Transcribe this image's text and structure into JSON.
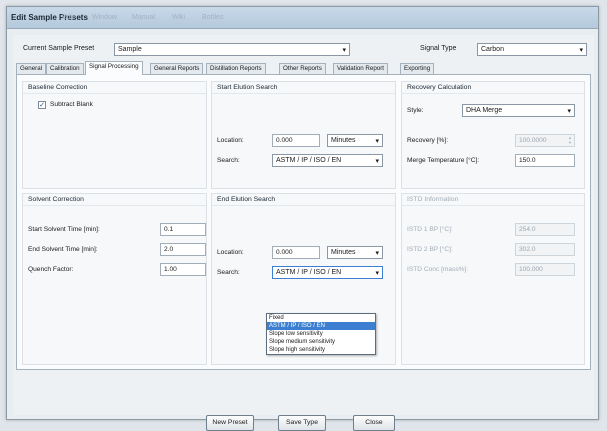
{
  "window": {
    "title": "Edit Sample Presets",
    "ghost_menu": [
      "Edit",
      "Window",
      "Manual",
      "Wiki",
      "Bottles"
    ]
  },
  "header": {
    "preset_label": "Current Sample Preset",
    "preset_value": "Sample",
    "signal_label": "Signal Type",
    "signal_value": "Carbon"
  },
  "tabs": [
    "General",
    "Calibration",
    "Signal Processing",
    "General Reports",
    "Distillation Reports",
    "Other Reports",
    "Validation Report",
    "Exporting"
  ],
  "active_tab": "Signal Processing",
  "baseline": {
    "title": "Baseline Correction",
    "subtract_label": "Subtract Blank",
    "subtract_checked": true
  },
  "start_elution": {
    "title": "Start Elution Search",
    "location_label": "Location:",
    "location_value": "0.000",
    "unit_value": "Minutes",
    "search_label": "Search:",
    "search_value": "ASTM / IP / ISO / EN"
  },
  "recovery": {
    "title": "Recovery Calculation",
    "style_label": "Style:",
    "style_value": "DHA Merge",
    "recovery_label": "Recovery [%]:",
    "recovery_value": "100.0000",
    "merge_label": "Merge Temperature [°C]:",
    "merge_value": "150.0"
  },
  "solvent": {
    "title": "Solvent Correction",
    "start_label": "Start Solvent Time [min]:",
    "start_value": "0.1",
    "end_label": "End Solvent Time [min]:",
    "end_value": "2.0",
    "quench_label": "Quench Factor:",
    "quench_value": "1.00"
  },
  "end_elution": {
    "title": "End Elution Search",
    "location_label": "Location:",
    "location_value": "0.000",
    "unit_value": "Minutes",
    "search_label": "Search:",
    "search_value": "ASTM / IP / ISO / EN",
    "options": [
      "Fixed",
      "ASTM / IP / ISO / EN",
      "Slope low sensitivity",
      "Slope medium sensitivity",
      "Slope high sensitivity"
    ],
    "selected_index": 1
  },
  "istd": {
    "title": "ISTD Information",
    "ibp_label": "ISTD 1 BP [°C]:",
    "ibp_value": "254.0",
    "bp2_label": "ISTD 2 BP [°C]:",
    "bp2_value": "302.0",
    "conc_label": "ISTD Conc [mass%]:",
    "conc_value": "100.000"
  },
  "buttons": {
    "new_preset": "New Preset",
    "save_type": "Save Type",
    "close": "Close"
  }
}
